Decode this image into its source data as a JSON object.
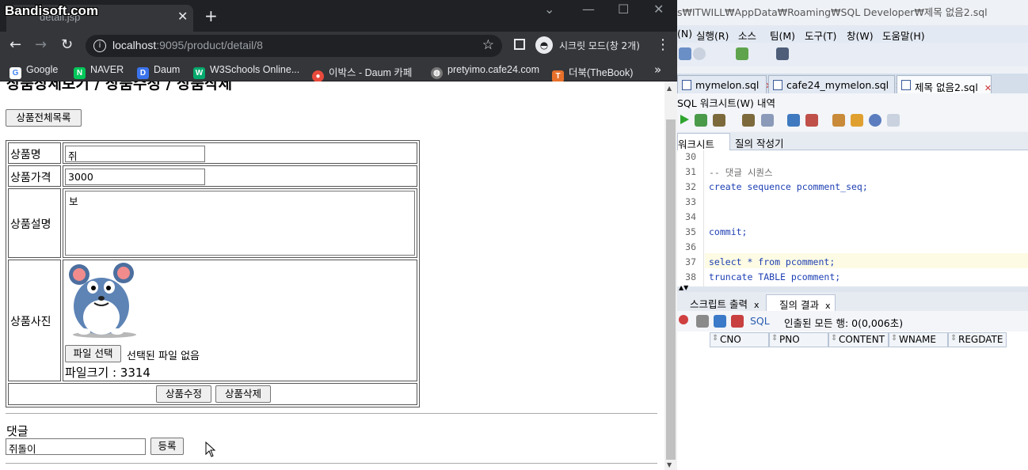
{
  "chrome": {
    "watermark": "Bandisoft.com",
    "tab_title": "detail.jsp",
    "url_host": "localhost",
    "url_rest": ":9095/product/detail/8",
    "incognito_label": "시크릿 모드(창 2개)",
    "bookmarks": [
      {
        "label": "Google",
        "color": "#ffffff",
        "glyph": "G"
      },
      {
        "label": "NAVER",
        "color": "#03c75a",
        "glyph": "N"
      },
      {
        "label": "Daum",
        "color": "#3b73ec",
        "glyph": "D"
      },
      {
        "label": "W3Schools Online...",
        "color": "#04aa6d",
        "glyph": "W"
      },
      {
        "label": "이박스 - Daum 카페",
        "color": "#e84a3c",
        "glyph": "●"
      },
      {
        "label": "pretyimo.cafe24.com",
        "color": "#777777",
        "glyph": "◍"
      },
      {
        "label": "더북(TheBook)",
        "color": "#e8702a",
        "glyph": "T"
      }
    ]
  },
  "page": {
    "heading": "상품상세보기 / 상품수정 / 상품삭제",
    "list_button": "상품전체목록",
    "labels": {
      "name": "상품명",
      "price": "상품가격",
      "desc": "상품설명",
      "photo": "상품사진"
    },
    "values": {
      "name": "쥐",
      "price": "3000",
      "desc": "보"
    },
    "file_button": "파일 선택",
    "file_status": "선택된 파일 없음",
    "file_size": "파일크기 : 3314",
    "update_button": "상품수정",
    "delete_button": "상품삭제",
    "reply_label": "댓글",
    "reply_value": "쥐돌이",
    "reply_button": "등록"
  },
  "sqldev": {
    "title_path": "s₩ITWILL₩AppData₩Roaming₩SQL Developer₩제목 없음2.sql",
    "menu": [
      "(N)",
      "실행(R)",
      "소스",
      "팀(M)",
      "도구(T)",
      "창(W)",
      "도움말(H)"
    ],
    "doc_tabs": [
      "mymelon.sql",
      "cafe24_mymelon.sql",
      "제목 없음2.sql"
    ],
    "sub_tabs": [
      "SQL 워크시트(W)",
      "내역"
    ],
    "query_tabs": [
      "워크시트",
      "질의 작성기"
    ],
    "lines": [
      {
        "n": "30",
        "text": ""
      },
      {
        "n": "31",
        "text": "-- 댓글 시퀀스"
      },
      {
        "n": "32",
        "text": "create sequence pcomment_seq;"
      },
      {
        "n": "33",
        "text": ""
      },
      {
        "n": "34",
        "text": ""
      },
      {
        "n": "35",
        "text": "commit;"
      },
      {
        "n": "36",
        "text": ""
      },
      {
        "n": "37",
        "text": "select * from pcomment;"
      },
      {
        "n": "38",
        "text": "truncate TABLE pcomment;"
      }
    ],
    "result_tabs": [
      "스크립트 출력",
      "질의 결과"
    ],
    "sql_link": "SQL",
    "fetch_text": "인출된 모든 행: 0(0,006초)",
    "columns": [
      "CNO",
      "PNO",
      "CONTENT",
      "WNAME",
      "REGDATE"
    ]
  }
}
